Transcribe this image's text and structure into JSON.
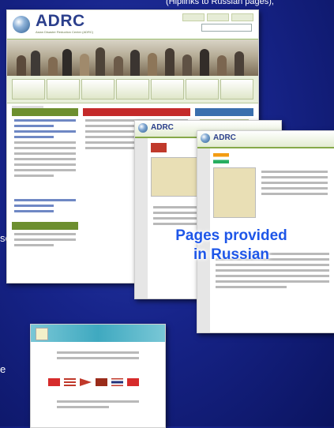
{
  "slide": {
    "top_fragment": "(Hiplinks to Russian pages),",
    "side_fragment_1": "se,",
    "side_fragment_2": "e",
    "overlay_line1": "Pages provided",
    "overlay_line2": "in Russian"
  },
  "main_screenshot": {
    "logo": "ADRC",
    "logo_sub": "Asian Disaster Reduction Center (ADRC)"
  },
  "russian_pages": {
    "logo_1": "ADRC",
    "logo_2": "ADRC"
  },
  "colors": {
    "background": "#17248a",
    "overlay_text": "#1e56e8",
    "green_bar": "#6d8f2f",
    "red_bar": "#c42a2a"
  }
}
